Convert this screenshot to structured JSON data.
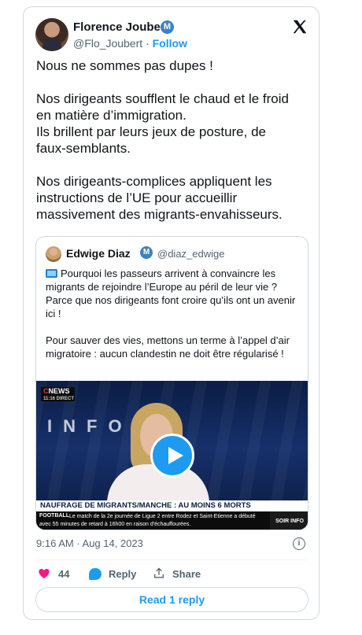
{
  "tweet": {
    "author_name": "Florence Joubert",
    "verified_mark": "M",
    "handle": "@Flo_Joubert",
    "separator": "·",
    "follow_label": "Follow",
    "paragraphs": [
      "Nous ne sommes pas dupes !",
      "Nos dirigeants soufflent le chaud et le froid\nen matière d’immigration.\nIls brillent par leurs jeux de posture, de\nfaux-semblants.",
      "Nos dirigeants-complices appliquent les\ninstructions de l’UE pour accueillir\nmassivement des migrants-envahisseurs."
    ],
    "timestamp": "9:16 AM · Aug 14, 2023"
  },
  "quoted_tweet": {
    "author_name": "Edwige Diaz",
    "verified_mark": "M",
    "handle": "@diaz_edwige",
    "emoji_icon": "television-icon",
    "paragraphs": [
      "Pourquoi les passeurs arrivent à convaincre les migrants de rejoindre l’Europe au péril de leur vie ? Parce que nos dirigeants font croire qu’ils ont un avenir ici !",
      "Pour sauver des vies, mettons un terme à l’appel d’air migratoire : aucun clandestin ne doit être régularisé !"
    ],
    "video": {
      "channel_c": "C",
      "channel_news": "NEWS",
      "channel_time": "11:16 DIRECT",
      "backdrop_word": "INFO",
      "headline": "NAUFRAGE DE MIGRANTS/MANCHE : AU MOINS 6 MORTS",
      "ticker_tag": "FOOTBALL",
      "ticker_text": "Le match de la 2e journée de Ligue 2 entre Rodez et Saint-Etienne a débuté avec 55 minutes de retard à 16h00 en raison d'échauffourées.",
      "segment_label": "SOIR INFO"
    }
  },
  "actions": {
    "like_count": "44",
    "reply_label": "Reply",
    "share_label": "Share",
    "read_replies_label": "Read 1 reply"
  },
  "colors": {
    "accent": "#1d9bf0",
    "like": "#f91880",
    "verified_badge": "#3b82c4",
    "secondary_text": "#536471"
  }
}
